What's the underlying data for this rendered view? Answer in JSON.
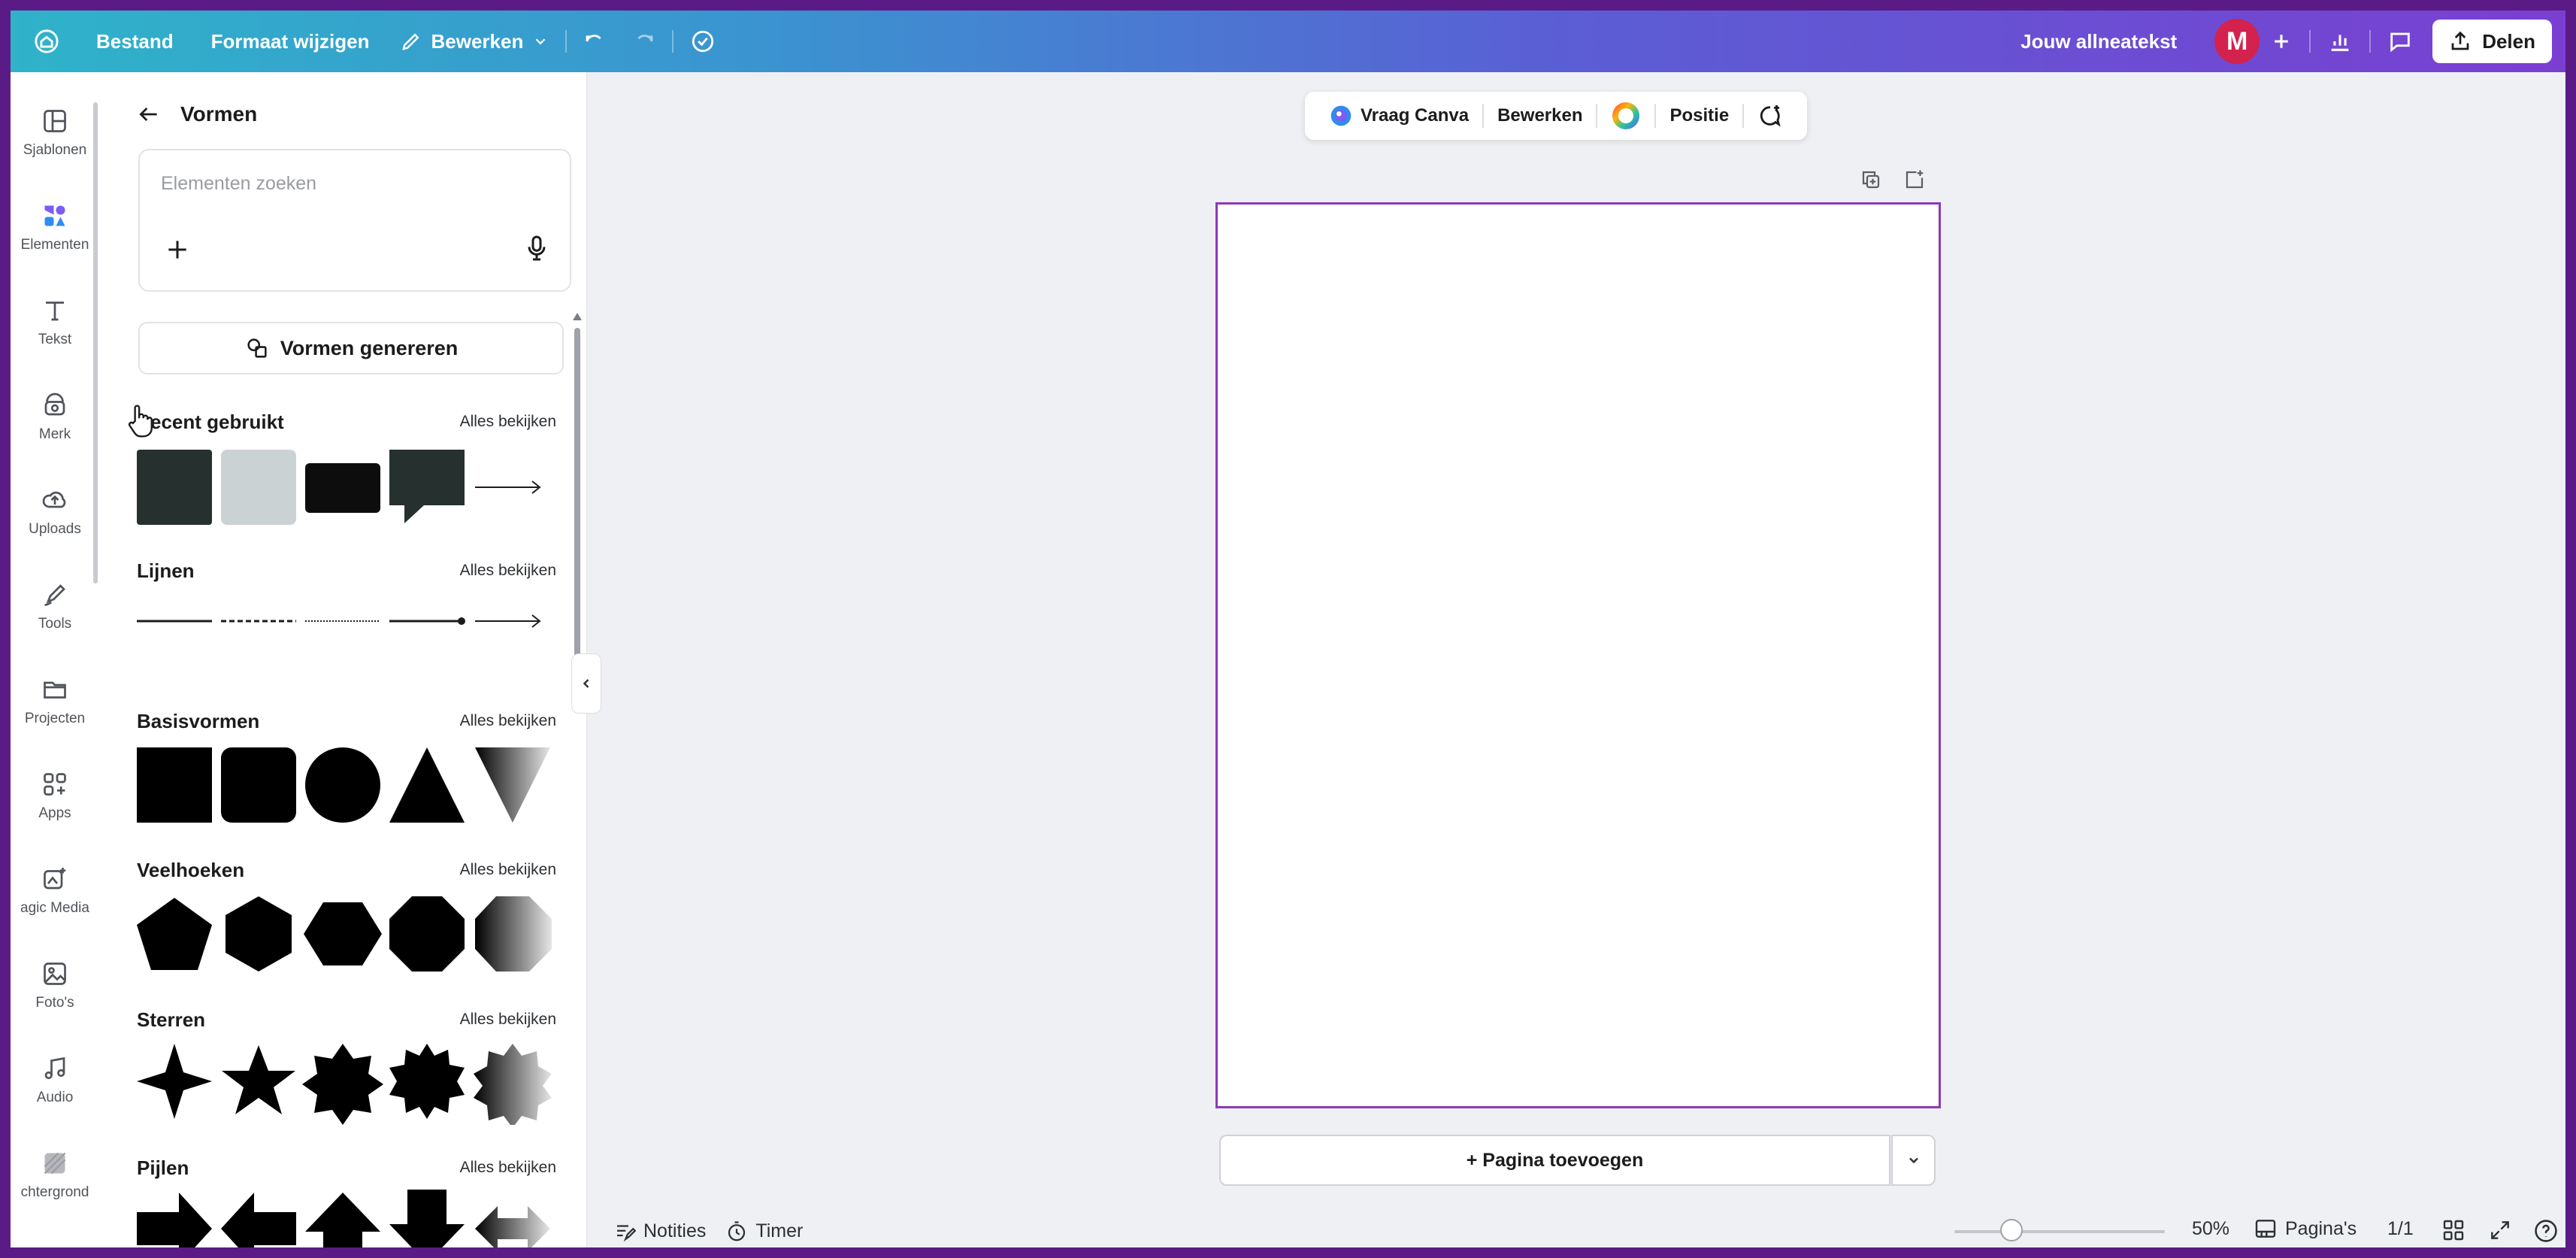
{
  "topbar": {
    "file": "Bestand",
    "resize": "Formaat wijzigen",
    "edit": "Bewerken",
    "doc_title": "Jouw allneatekst",
    "avatar_initial": "M",
    "share": "Delen",
    "gradient_start": "#2fb3c9",
    "gradient_end": "#7a3fd2"
  },
  "rail": {
    "items": [
      {
        "label": "Sjablonen",
        "icon": "templates-icon"
      },
      {
        "label": "Elementen",
        "icon": "elements-icon"
      },
      {
        "label": "Tekst",
        "icon": "text-icon"
      },
      {
        "label": "Merk",
        "icon": "brand-icon"
      },
      {
        "label": "Uploads",
        "icon": "upload-cloud-icon"
      },
      {
        "label": "Tools",
        "icon": "pen-icon"
      },
      {
        "label": "Projecten",
        "icon": "folder-icon"
      },
      {
        "label": "Apps",
        "icon": "apps-icon"
      },
      {
        "label": "agic Media",
        "icon": "magic-media-icon"
      },
      {
        "label": "Foto's",
        "icon": "photo-icon"
      },
      {
        "label": "Audio",
        "icon": "music-icon"
      },
      {
        "label": "chtergrond",
        "icon": "background-icon"
      }
    ]
  },
  "panel": {
    "title": "Vormen",
    "search_placeholder": "Elementen zoeken",
    "generate_button": "Vormen genereren",
    "see_all": "Alles bekijken",
    "sections": [
      {
        "title": "ecent gebruikt"
      },
      {
        "title": "Lijnen"
      },
      {
        "title": "Basisvormen"
      },
      {
        "title": "Veelhoeken"
      },
      {
        "title": "Sterren"
      },
      {
        "title": "Pijlen"
      }
    ]
  },
  "context_bar": {
    "ask": "Vraag Canva",
    "edit": "Bewerken",
    "position": "Positie"
  },
  "canvas": {
    "add_page": "+ Pagina toevoegen",
    "page_border_color": "#8a3ab9"
  },
  "bottombar": {
    "notes": "Notities",
    "timer": "Timer",
    "zoom": "50%",
    "pages_label": "Pagina's",
    "pages_count": "1/1",
    "zoom_value": 0.5
  }
}
